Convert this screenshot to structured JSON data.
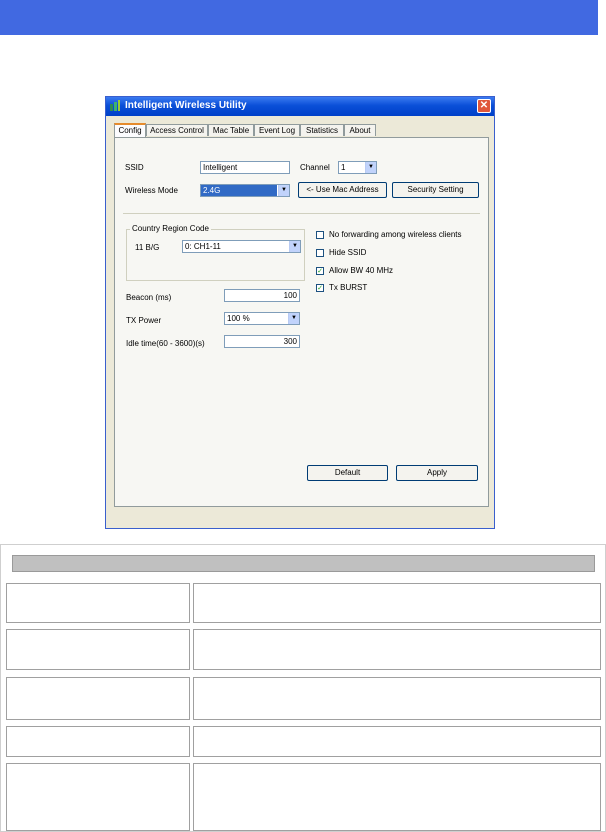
{
  "window": {
    "title": "Intelligent Wireless Utility",
    "close_glyph": "✕"
  },
  "tabs": [
    "Config",
    "Access Control",
    "Mac Table",
    "Event Log",
    "Statistics",
    "About"
  ],
  "config": {
    "ssid_label": "SSID",
    "ssid_value": "Intelligent",
    "channel_label": "Channel",
    "channel_value": "1",
    "wireless_mode_label": "Wireless Mode",
    "wireless_mode_value": "2.4G",
    "use_mac_button": "<- Use Mac Address",
    "security_button": "Security Setting",
    "country_group_label": "Country Region Code",
    "country_band_label": "11 B/G",
    "country_value": "0: CH1-11",
    "checkboxes": [
      {
        "label": "No forwarding among wireless clients",
        "checked": false
      },
      {
        "label": "Hide SSID",
        "checked": false
      },
      {
        "label": "Allow BW 40 MHz",
        "checked": true
      },
      {
        "label": "Tx BURST",
        "checked": true
      }
    ],
    "beacon_label": "Beacon (ms)",
    "beacon_value": "100",
    "tx_power_label": "TX Power",
    "tx_power_value": "100 %",
    "idle_label": "Idle time(60 - 3600)(s)",
    "idle_value": "300",
    "default_button": "Default",
    "apply_button": "Apply"
  },
  "colors": {
    "banner": "#4169e1",
    "titlebar": "#0a4fd8",
    "selection": "#316ac5"
  }
}
